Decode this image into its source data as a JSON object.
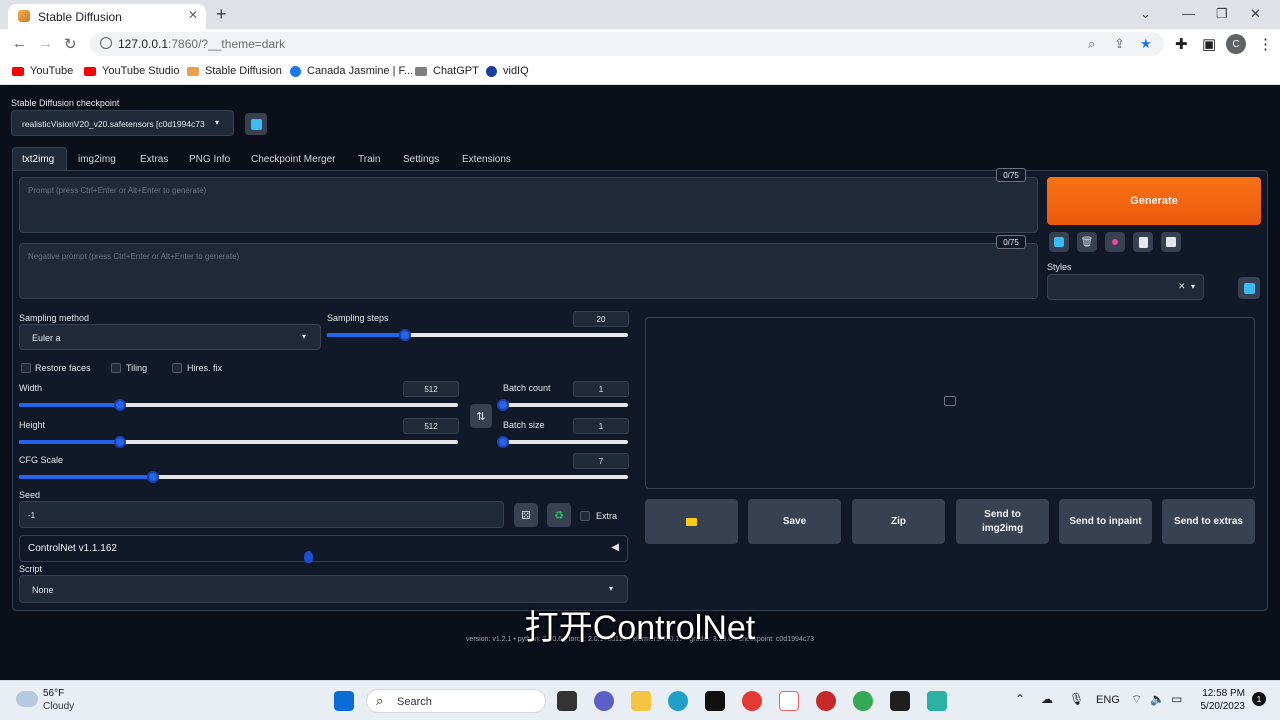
{
  "browser": {
    "tab_title": "Stable Diffusion",
    "url_host": "127.0.0.1",
    "url_path": ":7860/?__theme=dark",
    "profile_initial": "C",
    "bookmarks": [
      {
        "label": "YouTube",
        "color": "#ff0000"
      },
      {
        "label": "YouTube Studio",
        "color": "#ff0000"
      },
      {
        "label": "Stable Diffusion",
        "color": "#e8a04c"
      },
      {
        "label": "Canada Jasmine | F...",
        "color": "#1877f2"
      },
      {
        "label": "ChatGPT",
        "color": "#7e7e7e"
      },
      {
        "label": "vidIQ",
        "color": "#1a3fa0"
      }
    ]
  },
  "app": {
    "checkpoint_label": "Stable Diffusion checkpoint",
    "checkpoint_value": "realisticVisionV20_v20.safetensors [c0d1994c73",
    "tabs": [
      "txt2img",
      "img2img",
      "Extras",
      "PNG Info",
      "Checkpoint Merger",
      "Train",
      "Settings",
      "Extensions"
    ],
    "prompt_placeholder": "Prompt (press Ctrl+Enter or Alt+Enter to generate)",
    "negative_placeholder": "Negative prompt (press Ctrl+Enter or Alt+Enter to generate)",
    "prompt_counter": "0/75",
    "negative_counter": "0/75",
    "generate_label": "Generate",
    "styles_label": "Styles",
    "sampling_method_label": "Sampling method",
    "sampling_method_value": "Euler a",
    "sampling_steps_label": "Sampling steps",
    "sampling_steps_value": "20",
    "restore_faces": "Restore faces",
    "tiling": "Tiling",
    "hires_fix": "Hires. fix",
    "width_label": "Width",
    "width_value": "512",
    "height_label": "Height",
    "height_value": "512",
    "batch_count_label": "Batch count",
    "batch_count_value": "1",
    "batch_size_label": "Batch size",
    "batch_size_value": "1",
    "cfg_label": "CFG Scale",
    "cfg_value": "7",
    "seed_label": "Seed",
    "seed_value": "-1",
    "extra_label": "Extra",
    "controlnet_label": "ControlNet v1.1.162",
    "script_label": "Script",
    "script_value": "None",
    "output_buttons": [
      "Save",
      "Zip",
      "Send to img2img",
      "Send to inpaint",
      "Send to extras"
    ],
    "footer_version": "version: v1.2.1  •  python: 3.10.6  •  torch: 2.0.1+cu118  •  xformers: 0.0.17  •  gradio: 3.29.0  •  checkpoint: c0d1994c73",
    "subtitle": "打开ControlNet",
    "sliders": {
      "steps": 0.26,
      "width": 0.23,
      "height": 0.23,
      "batch_count": 0.0,
      "batch_size": 0.0,
      "cfg": 0.22
    }
  },
  "taskbar": {
    "weather_temp": "56°F",
    "weather_desc": "Cloudy",
    "search_label": "Search",
    "language": "ENG",
    "time": "12:58 PM",
    "date": "5/20/2023",
    "notification_count": "1"
  }
}
